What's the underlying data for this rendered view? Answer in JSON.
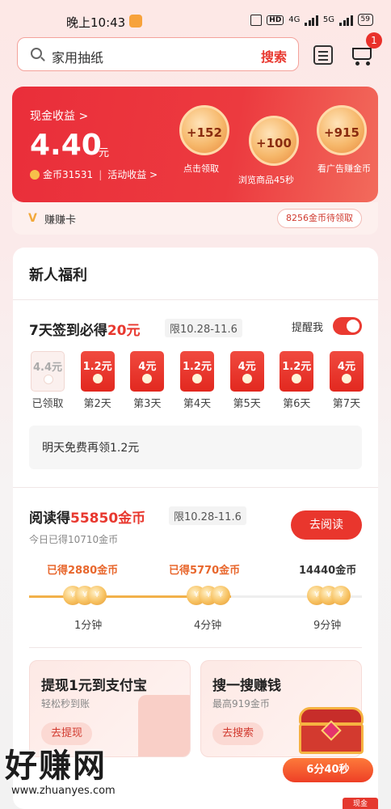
{
  "status_bar": {
    "time": "晚上10:43",
    "hd_label": "HD",
    "network_1": "4G",
    "network_2": "5G",
    "battery": "59"
  },
  "search": {
    "placeholder": "家用抽纸",
    "button_label": "搜索"
  },
  "header": {
    "cart_badge": "1"
  },
  "earnings": {
    "cash_label": "现金收益 >",
    "cash_value": "4.40",
    "cash_unit": "元",
    "coin_text": "金币31531",
    "activity_text": "活动收益 >",
    "bubbles": [
      {
        "value": "+152",
        "label": "点击领取"
      },
      {
        "value": "+100",
        "label": "浏览商品45秒"
      },
      {
        "value": "+915",
        "label": "看广告赚金币"
      }
    ],
    "footer_label": "赚赚卡",
    "pending_label": "8256金币待领取"
  },
  "welfare": {
    "title": "新人福利",
    "sign": {
      "title_prefix": "7天签到必得",
      "title_amount": "20元",
      "date_tag": "限10.28-11.6",
      "remind_label": "提醒我",
      "days": [
        {
          "amount": "4.4元",
          "label": "已领取",
          "claimed": true
        },
        {
          "amount": "1.2元",
          "label": "第2天",
          "claimed": false
        },
        {
          "amount": "4元",
          "label": "第3天",
          "claimed": false
        },
        {
          "amount": "1.2元",
          "label": "第4天",
          "claimed": false
        },
        {
          "amount": "4元",
          "label": "第5天",
          "claimed": false
        },
        {
          "amount": "1.2元",
          "label": "第6天",
          "claimed": false
        },
        {
          "amount": "4元",
          "label": "第7天",
          "claimed": false
        }
      ],
      "tomorrow_text": "明天免费再领1.2元"
    },
    "reading": {
      "title_prefix": "阅读得",
      "title_amount": "55850金币",
      "date_tag": "限10.28-11.6",
      "today_text": "今日已得10710金币",
      "button_label": "去阅读",
      "milestones": [
        {
          "reward": "已得2880金币",
          "time": "1分钟"
        },
        {
          "reward": "已得5770金币",
          "time": "4分钟"
        },
        {
          "reward": "14440金币",
          "time": "9分钟"
        }
      ]
    },
    "cards": [
      {
        "title": "提现1元到支付宝",
        "subtitle": "轻松秒到账",
        "button": "去提现"
      },
      {
        "title": "搜一搜赚钱",
        "subtitle": "最高919金币",
        "button": "去搜索"
      }
    ],
    "floating_timer": "6分40秒"
  },
  "watermark": {
    "brand": "好赚网",
    "url": "www.zhuanyes.com"
  },
  "bottom_badge": "现金"
}
